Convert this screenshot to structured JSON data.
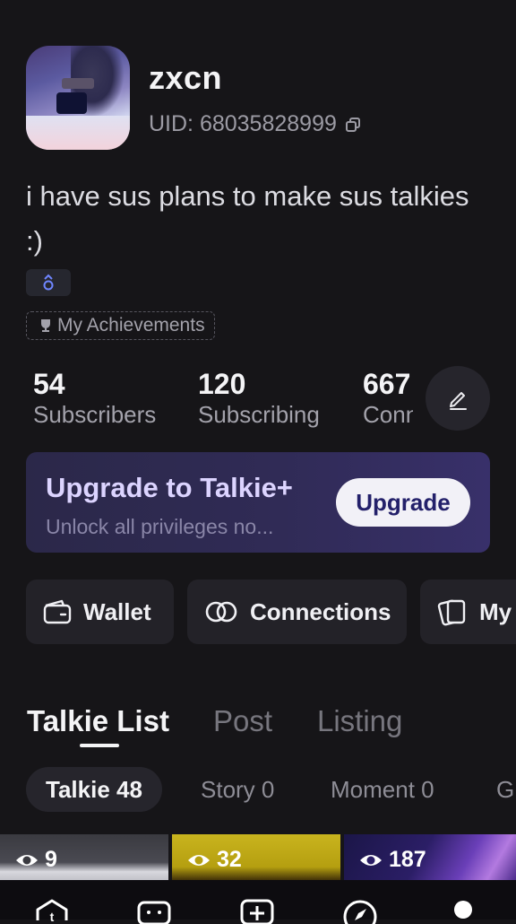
{
  "profile": {
    "username": "zxcn",
    "uid": "UID: 68035828999",
    "bio": "i have sus plans to make sus talkies :)",
    "achievements_label": "My Achievements"
  },
  "stats": [
    {
      "value": "54",
      "label": "Subscribers"
    },
    {
      "value": "120",
      "label": "Subscribing"
    },
    {
      "value": "667",
      "label": "Connections"
    }
  ],
  "upgrade": {
    "title": "Upgrade to Talkie+",
    "subtitle": "Unlock all privileges no...",
    "button_label": "Upgrade"
  },
  "quick_actions": [
    {
      "label": "Wallet",
      "icon": "wallet-icon"
    },
    {
      "label": "Connections",
      "icon": "connections-icon"
    },
    {
      "label": "My",
      "icon": "cards-icon"
    }
  ],
  "tabs": [
    {
      "label": "Talkie List",
      "active": true
    },
    {
      "label": "Post",
      "active": false
    },
    {
      "label": "Listing",
      "active": false
    }
  ],
  "sub_tabs": [
    {
      "label": "Talkie 48",
      "active": true
    },
    {
      "label": "Story 0",
      "active": false
    },
    {
      "label": "Moment 0",
      "active": false
    },
    {
      "label": "Gr",
      "active": false
    }
  ],
  "thumbnails": [
    {
      "views": "9"
    },
    {
      "views": "32"
    },
    {
      "views": "187"
    }
  ],
  "bottom_nav": [
    "home-icon",
    "chat-icon",
    "create-icon",
    "explore-icon",
    "profile-icon"
  ],
  "colors": {
    "background": "#161518",
    "card": "#232228",
    "upgrade_gradient_start": "#2b2849",
    "upgrade_gradient_end": "#38306a",
    "accent_text": "#23206a"
  }
}
